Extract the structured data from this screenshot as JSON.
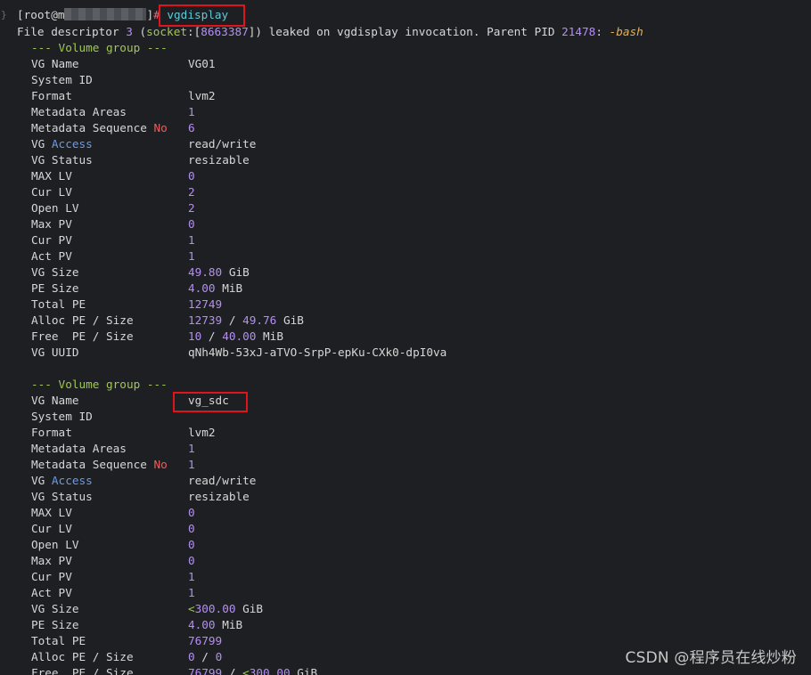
{
  "prompt": {
    "open": "[root@m",
    "close": "]",
    "symbol": "#",
    "command": "vgdisplay"
  },
  "warning": {
    "p1": "File descriptor ",
    "fd": "3",
    "p2": " (",
    "socket": "socket",
    "p3": ":[",
    "inode": "8663387",
    "p4": "]) leaked on vgdisplay invocation. Parent PID ",
    "pid": "21478",
    "p5": ": ",
    "shell": "-bash"
  },
  "groups": [
    {
      "header": "--- Volume group ---",
      "vg_name": "VG01",
      "system_id": "",
      "format": "lvm2",
      "metadata_areas": "1",
      "metadata_sequence": "6",
      "vg_access": "read/write",
      "vg_status": "resizable",
      "max_lv": "0",
      "cur_lv": "2",
      "open_lv": "2",
      "max_pv": "0",
      "cur_pv": "1",
      "act_pv": "1",
      "vg_size_num": "49.80",
      "vg_size_unit": "GiB",
      "pe_size_num": "4.00",
      "pe_size_unit": "MiB",
      "total_pe": "12749",
      "alloc_pe": "12739",
      "alloc_size_num": "49.76",
      "alloc_size_unit": "GiB",
      "free_pe": "10",
      "free_size_num": "40.00",
      "free_size_unit": "MiB",
      "vg_uuid": "qNh4Wb-53xJ-aTVO-SrpP-epKu-CXk0-dpI0va"
    },
    {
      "header": "--- Volume group ---",
      "vg_name": "vg_sdc",
      "system_id": "",
      "format": "lvm2",
      "metadata_areas": "1",
      "metadata_sequence": "1",
      "vg_access": "read/write",
      "vg_status": "resizable",
      "max_lv": "0",
      "cur_lv": "0",
      "open_lv": "0",
      "max_pv": "0",
      "cur_pv": "1",
      "act_pv": "1",
      "vg_size_lt": "<",
      "vg_size_num": "300.00",
      "vg_size_unit": "GiB",
      "pe_size_num": "4.00",
      "pe_size_unit": "MiB",
      "total_pe": "76799",
      "alloc_pe": "0",
      "alloc_size_num": "0",
      "free_pe": "76799",
      "free_size_lt": "<",
      "free_size_num": "300.00",
      "free_size_unit": "GiB"
    }
  ],
  "labels": {
    "vg_name": "VG Name",
    "system_id": "System ID",
    "format": "Format",
    "metadata_areas": "Metadata Areas",
    "metadata_sequence_a": "Metadata Sequence ",
    "metadata_sequence_b": "No",
    "vg_access_a": "VG ",
    "vg_access_b": "Access",
    "vg_status": "VG Status",
    "max_lv": "MAX LV",
    "cur_lv": "Cur LV",
    "open_lv": "Open LV",
    "max_pv": "Max PV",
    "cur_pv": "Cur PV",
    "act_pv": "Act PV",
    "vg_size": "VG Size",
    "pe_size": "PE Size",
    "total_pe": "Total PE",
    "alloc_pe_size": "Alloc PE / Size",
    "free_pe_size": "Free  PE / Size",
    "vg_uuid": "VG UUID",
    "slash": " / "
  },
  "gutter_icon": "brace-icon",
  "gutter_glyph": "}",
  "watermark": "CSDN @程序员在线炒粉",
  "colors": {
    "background": "#1e1f22",
    "text": "#d7d7d7",
    "number": "#b48ef5",
    "command": "#60c9d8",
    "highlight_box": "#e0141c"
  }
}
